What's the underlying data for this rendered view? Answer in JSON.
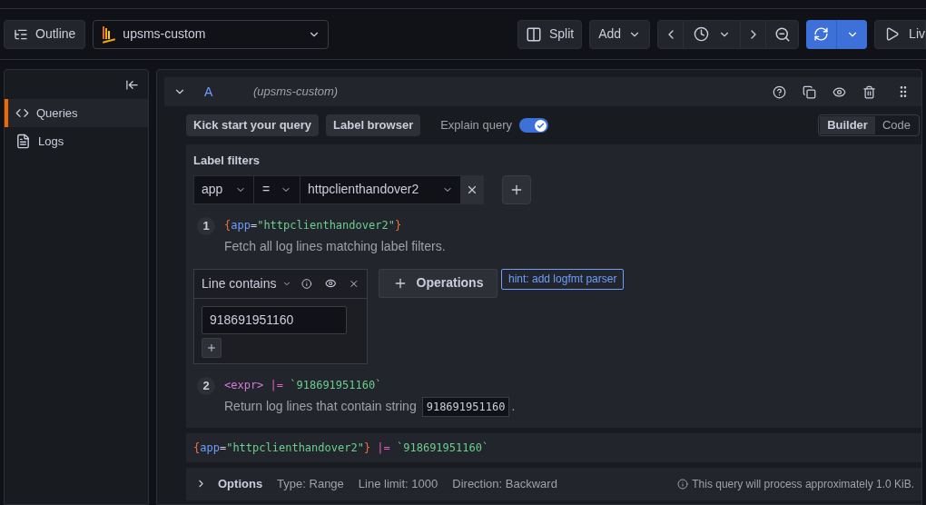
{
  "toolbar": {
    "outline": "Outline",
    "datasource": "upsms-custom",
    "split": "Split",
    "add": "Add",
    "live": "Liv"
  },
  "sidebar": {
    "items": [
      {
        "kind": "code",
        "label": "Queries",
        "selected": true
      },
      {
        "kind": "log",
        "label": "Logs",
        "selected": false
      }
    ]
  },
  "query": {
    "letter": "A",
    "datasource": "(upsms-custom)",
    "expanded": true,
    "actions": {
      "kickstart": "Kick start your query",
      "label_browser": "Label browser",
      "explain_label": "Explain query",
      "explain_on": true
    },
    "modes": [
      {
        "label": "Builder",
        "selected": true
      },
      {
        "label": "Code",
        "selected": false
      }
    ],
    "label_filters": {
      "title": "Label filters",
      "label": "app",
      "operator": "=",
      "value": "httpclienthandover2"
    },
    "steps": [
      {
        "number": "1",
        "code": [
          {
            "kind": "brace",
            "text": "{"
          },
          {
            "kind": "key",
            "text": "app"
          },
          {
            "kind": "plain",
            "text": "="
          },
          {
            "kind": "string",
            "text": "\"httpclienthandover2\""
          },
          {
            "kind": "brace",
            "text": "}"
          }
        ],
        "text": "Fetch all log lines matching label filters."
      },
      {
        "number": "2",
        "code": [
          {
            "kind": "expr",
            "text": "<expr> "
          },
          {
            "kind": "pipe",
            "text": "|= "
          },
          {
            "kind": "string",
            "text": "`918691951160`"
          }
        ],
        "text": "Return log lines that contain string",
        "chip": "918691951160",
        "after": "."
      }
    ],
    "operation": {
      "name": "Line contains",
      "value": "918691951160"
    },
    "operations_button": "Operations",
    "hint": "hint: add logfmt parser",
    "preview": [
      {
        "kind": "brace",
        "text": "{"
      },
      {
        "kind": "key",
        "text": "app"
      },
      {
        "kind": "plain",
        "text": "="
      },
      {
        "kind": "string",
        "text": "\"httpclienthandover2\""
      },
      {
        "kind": "brace",
        "text": "} "
      },
      {
        "kind": "pipe",
        "text": "|= "
      },
      {
        "kind": "string",
        "text": "`918691951160`"
      }
    ],
    "options": {
      "title": "Options",
      "expanded": false,
      "items": [
        "Type: Range",
        "Line limit: 1000",
        "Direction: Backward"
      ],
      "estimate": "This query will process approximately 1.0 KiB."
    }
  }
}
